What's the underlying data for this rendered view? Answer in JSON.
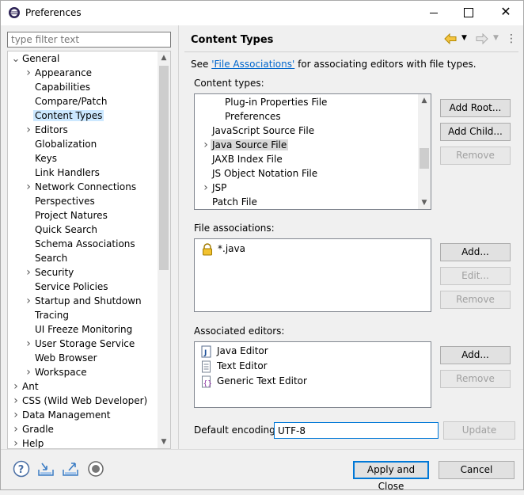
{
  "window": {
    "title": "Preferences"
  },
  "filter": {
    "placeholder": "type filter text"
  },
  "tree": {
    "items": [
      {
        "label": "General",
        "arrow": "expanded",
        "level": 0
      },
      {
        "label": "Appearance",
        "arrow": "collapsed",
        "level": 1
      },
      {
        "label": "Capabilities",
        "arrow": "none",
        "level": 1
      },
      {
        "label": "Compare/Patch",
        "arrow": "none",
        "level": 1
      },
      {
        "label": "Content Types",
        "arrow": "none",
        "level": 1,
        "selected": true
      },
      {
        "label": "Editors",
        "arrow": "collapsed",
        "level": 1
      },
      {
        "label": "Globalization",
        "arrow": "none",
        "level": 1
      },
      {
        "label": "Keys",
        "arrow": "none",
        "level": 1
      },
      {
        "label": "Link Handlers",
        "arrow": "none",
        "level": 1
      },
      {
        "label": "Network Connections",
        "arrow": "collapsed",
        "level": 1
      },
      {
        "label": "Perspectives",
        "arrow": "none",
        "level": 1
      },
      {
        "label": "Project Natures",
        "arrow": "none",
        "level": 1
      },
      {
        "label": "Quick Search",
        "arrow": "none",
        "level": 1
      },
      {
        "label": "Schema Associations",
        "arrow": "none",
        "level": 1
      },
      {
        "label": "Search",
        "arrow": "none",
        "level": 1
      },
      {
        "label": "Security",
        "arrow": "collapsed",
        "level": 1
      },
      {
        "label": "Service Policies",
        "arrow": "none",
        "level": 1
      },
      {
        "label": "Startup and Shutdown",
        "arrow": "collapsed",
        "level": 1
      },
      {
        "label": "Tracing",
        "arrow": "none",
        "level": 1
      },
      {
        "label": "UI Freeze Monitoring",
        "arrow": "none",
        "level": 1
      },
      {
        "label": "User Storage Service",
        "arrow": "collapsed",
        "level": 1
      },
      {
        "label": "Web Browser",
        "arrow": "none",
        "level": 1
      },
      {
        "label": "Workspace",
        "arrow": "collapsed",
        "level": 1
      },
      {
        "label": "Ant",
        "arrow": "collapsed",
        "level": 0
      },
      {
        "label": "CSS (Wild Web Developer)",
        "arrow": "collapsed",
        "level": 0
      },
      {
        "label": "Data Management",
        "arrow": "collapsed",
        "level": 0
      },
      {
        "label": "Gradle",
        "arrow": "collapsed",
        "level": 0
      },
      {
        "label": "Help",
        "arrow": "collapsed",
        "level": 0
      }
    ]
  },
  "page": {
    "title": "Content Types",
    "description_prefix": "See ",
    "description_link": "'File Associations'",
    "description_suffix": " for associating editors with file types.",
    "content_types_label": "Content types:",
    "content_types_mnemonic": "C",
    "content_types": [
      {
        "label": "Plug-in Properties File",
        "level": 2,
        "arrow": "none"
      },
      {
        "label": "Preferences",
        "level": 2,
        "arrow": "none"
      },
      {
        "label": "JavaScript Source File",
        "level": 1,
        "arrow": "none"
      },
      {
        "label": "Java Source File",
        "level": 1,
        "arrow": "collapsed",
        "selected": true
      },
      {
        "label": "JAXB Index File",
        "level": 1,
        "arrow": "none"
      },
      {
        "label": "JS Object Notation File",
        "level": 1,
        "arrow": "none"
      },
      {
        "label": "JSP",
        "level": 1,
        "arrow": "collapsed"
      },
      {
        "label": "Patch File",
        "level": 1,
        "arrow": "none"
      }
    ],
    "add_root": "Add Root...",
    "add_child": "Add Child...",
    "remove_ct": "Remove",
    "file_assoc_label": "File associations:",
    "file_assoc": [
      {
        "label": "*.java",
        "icon": "lock-icon"
      }
    ],
    "fa_add": "Add...",
    "fa_edit": "Edit...",
    "fa_remove": "Remove",
    "assoc_editors_label": "Associated editors:",
    "assoc_editors": [
      {
        "label": "Java Editor",
        "icon": "java-editor-icon"
      },
      {
        "label": "Text Editor",
        "icon": "text-file-icon"
      },
      {
        "label": "Generic Text Editor",
        "icon": "generic-editor-icon"
      }
    ],
    "ae_add": "Add...",
    "ae_remove": "Remove",
    "encoding_label": "Default encoding:",
    "encoding_value": "UTF-8",
    "update": "Update"
  },
  "footer": {
    "apply_close": "Apply and Close",
    "cancel": "Cancel",
    "icons": [
      "help-icon",
      "import-icon",
      "export-icon",
      "record-icon"
    ]
  },
  "colors": {
    "selection": "#cce8ff",
    "link": "#0066cc",
    "focus": "#0078d7"
  }
}
